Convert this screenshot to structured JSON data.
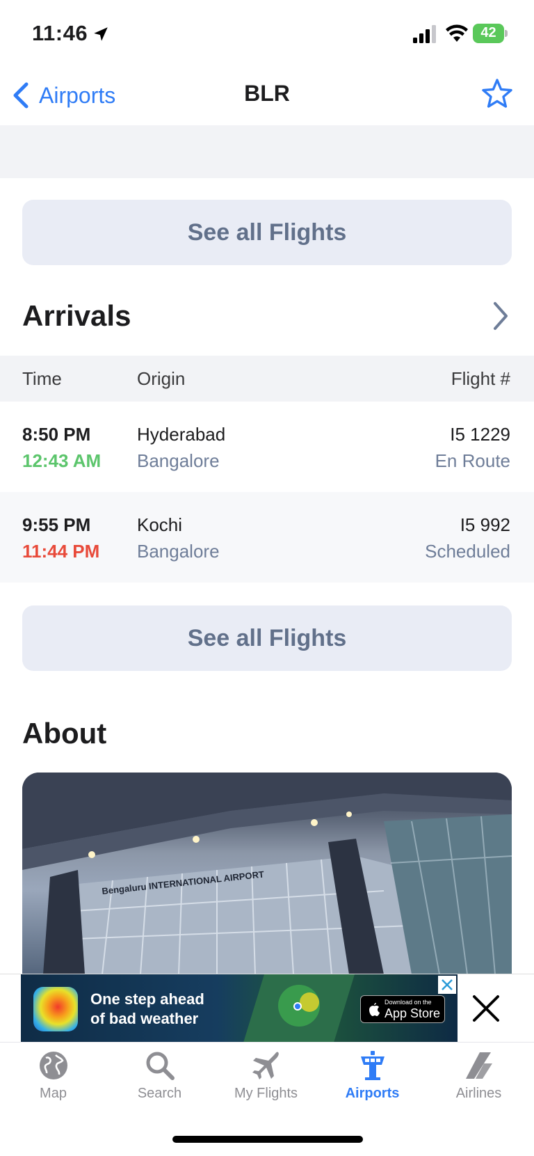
{
  "status_bar": {
    "time": "11:46",
    "battery": "42"
  },
  "nav": {
    "back_label": "Airports",
    "title": "BLR"
  },
  "departures_see_all": "See all Flights",
  "arrivals": {
    "title": "Arrivals",
    "columns": {
      "time": "Time",
      "origin": "Origin",
      "flight": "Flight #"
    },
    "rows": [
      {
        "scheduled": "8:50 PM",
        "actual": "12:43 AM",
        "origin": "Hyderabad",
        "destination": "Bangalore",
        "flight": "I5 1229",
        "status": "En Route",
        "actual_color": "#5cc56c"
      },
      {
        "scheduled": "9:55 PM",
        "actual": "11:44 PM",
        "origin": "Kochi",
        "destination": "Bangalore",
        "flight": "I5 992",
        "status": "Scheduled",
        "actual_color": "#e84a3a"
      }
    ],
    "see_all": "See all Flights"
  },
  "about": {
    "title": "About",
    "photo_caption": "Bengaluru INTERNATIONAL AIRPORT"
  },
  "ad": {
    "line1": "One step ahead",
    "line2": "of bad weather",
    "store_small": "Download on the",
    "store_big": "App Store"
  },
  "tabs": [
    {
      "label": "Map",
      "icon": "globe-icon",
      "active": false
    },
    {
      "label": "Search",
      "icon": "search-icon",
      "active": false
    },
    {
      "label": "My Flights",
      "icon": "plane-icon",
      "active": false
    },
    {
      "label": "Airports",
      "icon": "control-tower-icon",
      "active": true
    },
    {
      "label": "Airlines",
      "icon": "airline-tail-icon",
      "active": false
    }
  ],
  "colors": {
    "accent": "#2f7cf6",
    "secondary_text": "#6e7d98",
    "pill_bg": "#e9ecf5"
  }
}
